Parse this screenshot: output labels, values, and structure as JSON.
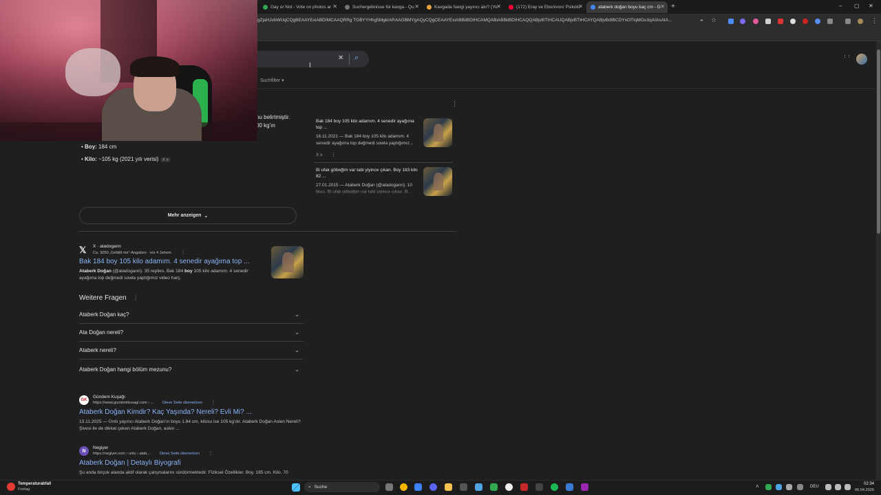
{
  "browser": {
    "tabs": [
      {
        "title": "Gay or Not - Vote on photos ar",
        "color": "#34a853"
      },
      {
        "title": "Suchergebnisse für kavga - Qu",
        "color": "#777777"
      },
      {
        "title": "Kavgada hangi yayıncı alır? (Yo",
        "color": "#e8a33c"
      },
      {
        "title": "(172) Eray ve Ebonivon/ Psikolo",
        "color": "#ff0033"
      },
      {
        "title": "ataberk doğan boyu kaç cm - G",
        "color": "#4285f4"
      }
    ],
    "new_tab": "+",
    "url": "gZjaHJvbWUqCQgBEAAYExiABDIMCAAQRRg TGBYYHhg5MgkIARAAGBMYgAQyCQgCEAAYExiABBiiBDIHCAMQABiABBiiBDIHCAQQABjvBTIHCAUQABjvBTIHCAYQABjvBdIBCDYxOTIqMGo3qAIAsAIA...",
    "window_controls": {
      "min": "–",
      "max": "▢",
      "close": "✕"
    }
  },
  "search": {
    "close_glyph": "✕",
    "search_glyph": "⌕",
    "suchfilter": "Suchfilter",
    "apps_glyph": "⋮⋮⋮"
  },
  "ai_overview": {
    "fragment1": "nu belirtmiştir.",
    "fragment2": "00 kg'ın",
    "facts": [
      {
        "label": "Boy:",
        "value": " 184 cm"
      },
      {
        "label": "Kilo:",
        "value": " ~105 kg (2021 yılı verisi)",
        "source": "X x"
      }
    ],
    "more_button": "Mehr anzeigen",
    "sources": [
      {
        "title": "Bak 184 boy 105 kilo adamım. 4 senedir ayağıma top ...",
        "date_snippet": "16.11.2021 — Bak 184 boy 105 kilo adamım. 4 senedir ayağıma top değmedi sowla yaptığımız...",
        "source": "X x"
      },
      {
        "title": "Bi ufak göbeğim var tabi yiyince çıkan. Boy 183 kilo 82 ...",
        "date_snippet": "27.01.2015 — Ataberk Doğan (@atadogann). 10 likes. Bi ufak göbeğim var tabi yiyince çıkan. B..."
      }
    ]
  },
  "results": [
    {
      "site": "X · atadogann",
      "meta": "Ca. 3050 „Gefällt mir“-Angaben · vor 4 Jahren",
      "title": "Bak 184 boy 105 kilo adamım. 4 senedir ayağıma top ...",
      "snippet_b1": "Ataberk Doğan",
      "snippet_rest": " (@atadogann). 35 replies. Bak 184 ",
      "snippet_b2": "boy",
      "snippet_rest2": " 105 kilo adamım. 4 senedir ayağıma top değmedi sowla yaptığımız video harç."
    },
    {
      "site": "Gündem Kuşağı",
      "url": "https://www.gundemkusagi.com › ...",
      "translate": "Diese Seite übersetzen",
      "title": "Ataberk Doğan Kimdir? Kaç Yaşında? Nereli? Evli Mi? ...",
      "snippet": "13.11.2025 — Ünlü yayıncı Ataberk Doğan'ın boyu 1.84 cm, kilosu ise 105 kg'dır. Ataberk Doğan Aslen Nereli? Şivesi ile de dikkat çeken Ataberk Doğan, aslen ..."
    },
    {
      "site": "Negiyer",
      "url": "https://negiyer.com › unlu › atab...",
      "translate": "Diese Seite übersetzen",
      "title": "Ataberk Doğan | Detaylı Biyografi",
      "snippet": "Şu anda birçok alanda aktif olarak çalışmalarını sürdürmektedir. Fiziksel Özellikler. Boy. 185 cm. Kilo. 70"
    }
  ],
  "weitere_fragen": {
    "heading": "Weitere Fragen",
    "questions": [
      "Ataberk Doğan kaç?",
      "Ata Doğan nereli?",
      "Ataberk nereli?",
      "Ataberk Doğan hangi bölüm mezunu?"
    ]
  },
  "taskbar": {
    "weather_title": "Temperaturabfall",
    "weather_sub": "Freitag",
    "search_label": "Suche",
    "lang": "DEU",
    "time": "02:34",
    "date": "06.04.2026"
  }
}
